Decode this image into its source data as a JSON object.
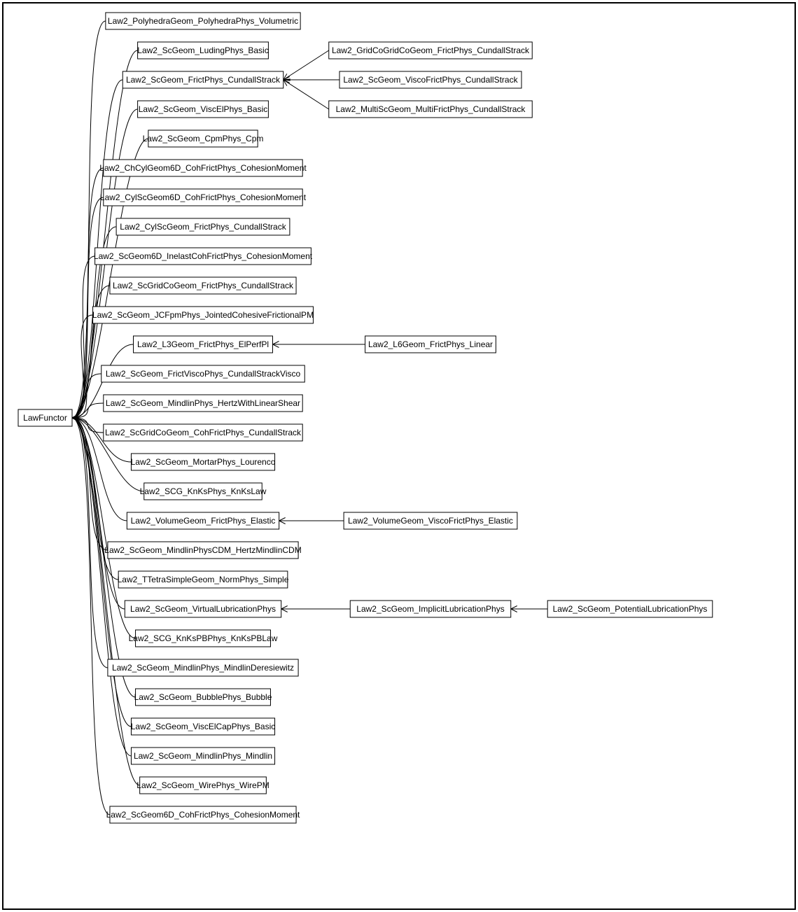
{
  "diagram": {
    "root": {
      "id": "LawFunctor",
      "label": "LawFunctor"
    },
    "children": [
      {
        "id": "n0",
        "label": "Law2_PolyhedraGeom_PolyhedraPhys_Volumetric"
      },
      {
        "id": "n1",
        "label": "Law2_ScGeom_LudingPhys_Basic"
      },
      {
        "id": "n2",
        "label": "Law2_ScGeom_FrictPhys_CundallStrack"
      },
      {
        "id": "n3",
        "label": "Law2_ScGeom_ViscElPhys_Basic"
      },
      {
        "id": "n4",
        "label": "Law2_ScGeom_CpmPhys_Cpm"
      },
      {
        "id": "n5",
        "label": "Law2_ChCylGeom6D_CohFrictPhys_CohesionMoment"
      },
      {
        "id": "n6",
        "label": "Law2_CylScGeom6D_CohFrictPhys_CohesionMoment"
      },
      {
        "id": "n7",
        "label": "Law2_CylScGeom_FrictPhys_CundallStrack"
      },
      {
        "id": "n8",
        "label": "Law2_ScGeom6D_InelastCohFrictPhys_CohesionMoment"
      },
      {
        "id": "n9",
        "label": "Law2_ScGridCoGeom_FrictPhys_CundallStrack"
      },
      {
        "id": "n10",
        "label": "Law2_ScGeom_JCFpmPhys_JointedCohesiveFrictionalPM"
      },
      {
        "id": "n11",
        "label": "Law2_L3Geom_FrictPhys_ElPerfPl"
      },
      {
        "id": "n12",
        "label": "Law2_ScGeom_FrictViscoPhys_CundallStrackVisco"
      },
      {
        "id": "n13",
        "label": "Law2_ScGeom_MindlinPhys_HertzWithLinearShear"
      },
      {
        "id": "n14",
        "label": "Law2_ScGridCoGeom_CohFrictPhys_CundallStrack"
      },
      {
        "id": "n15",
        "label": "Law2_ScGeom_MortarPhys_Lourenco"
      },
      {
        "id": "n16",
        "label": "Law2_SCG_KnKsPhys_KnKsLaw"
      },
      {
        "id": "n17",
        "label": "Law2_VolumeGeom_FrictPhys_Elastic"
      },
      {
        "id": "n18",
        "label": "Law2_ScGeom_MindlinPhysCDM_HertzMindlinCDM"
      },
      {
        "id": "n19",
        "label": "Law2_TTetraSimpleGeom_NormPhys_Simple"
      },
      {
        "id": "n20",
        "label": "Law2_ScGeom_VirtualLubricationPhys"
      },
      {
        "id": "n21",
        "label": "Law2_SCG_KnKsPBPhys_KnKsPBLaw"
      },
      {
        "id": "n22",
        "label": "Law2_ScGeom_MindlinPhys_MindlinDeresiewitz"
      },
      {
        "id": "n23",
        "label": "Law2_ScGeom_BubblePhys_Bubble"
      },
      {
        "id": "n24",
        "label": "Law2_ScGeom_ViscElCapPhys_Basic"
      },
      {
        "id": "n25",
        "label": "Law2_ScGeom_MindlinPhys_Mindlin"
      },
      {
        "id": "n26",
        "label": "Law2_ScGeom_WirePhys_WirePM"
      },
      {
        "id": "n27",
        "label": "Law2_ScGeom6D_CohFrictPhys_CohesionMoment"
      }
    ],
    "secondary": [
      {
        "id": "s0",
        "label": "Law2_GridCoGridCoGeom_FrictPhys_CundallStrack",
        "parent": "n2",
        "row": 0
      },
      {
        "id": "s1",
        "label": "Law2_ScGeom_ViscoFrictPhys_CundallStrack",
        "parent": "n2",
        "row": 1
      },
      {
        "id": "s2",
        "label": "Law2_MultiScGeom_MultiFrictPhys_CundallStrack",
        "parent": "n2",
        "row": 2
      },
      {
        "id": "s3",
        "label": "Law2_L6Geom_FrictPhys_Linear",
        "parent": "n11"
      },
      {
        "id": "s4",
        "label": "Law2_VolumeGeom_ViscoFrictPhys_Elastic",
        "parent": "n17"
      },
      {
        "id": "s5",
        "label": "Law2_ScGeom_ImplicitLubricationPhys",
        "parent": "n20"
      },
      {
        "id": "s6",
        "label": "Law2_ScGeom_PotentialLubricationPhys",
        "parent": "s5"
      }
    ]
  }
}
